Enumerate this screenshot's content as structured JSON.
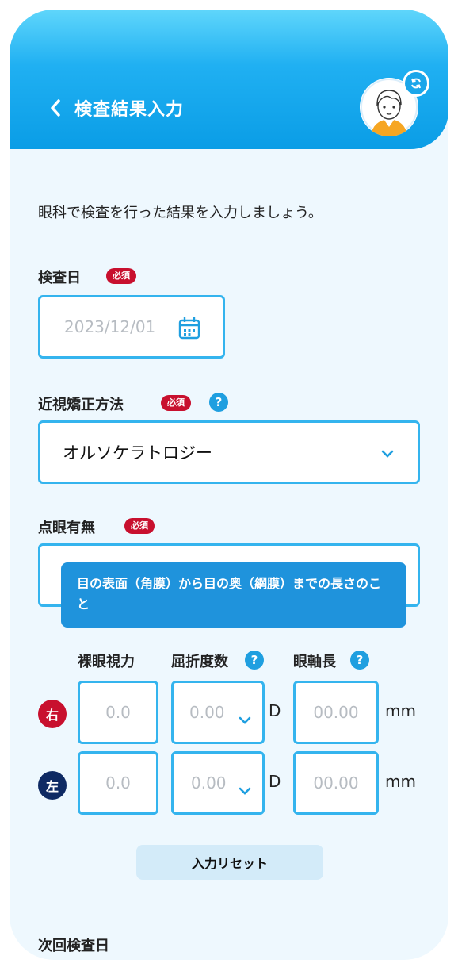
{
  "header": {
    "title": "検査結果入力"
  },
  "intro": "眼科で検査を行った結果を入力しましょう。",
  "exam_date": {
    "label": "検査日",
    "required": "必須",
    "value": "2023/12/01"
  },
  "correction": {
    "label": "近視矯正方法",
    "required": "必須",
    "help": "?",
    "value": "オルソケラトロジー"
  },
  "eyedrops": {
    "label": "点眼有無",
    "required": "必須"
  },
  "tooltip": "目の表面（角膜）から目の奥（網膜）までの長さのこと",
  "table": {
    "col_vision": "裸眼視力",
    "col_refraction": "屈折度数",
    "col_axial": "眼軸長",
    "help": "?",
    "right": {
      "side": "右",
      "vision": "0.0",
      "refraction": "0.00",
      "axial": "00.00"
    },
    "left": {
      "side": "左",
      "vision": "0.0",
      "refraction": "0.00",
      "axial": "00.00"
    },
    "unit_d": "D",
    "unit_mm": "mm"
  },
  "reset_label": "入力リセット",
  "next_exam": {
    "label": "次回検査日"
  },
  "colors": {
    "accent": "#1aa6ea",
    "required": "#c8102e",
    "right_badge": "#c8102e",
    "left_badge": "#0e2a63"
  }
}
